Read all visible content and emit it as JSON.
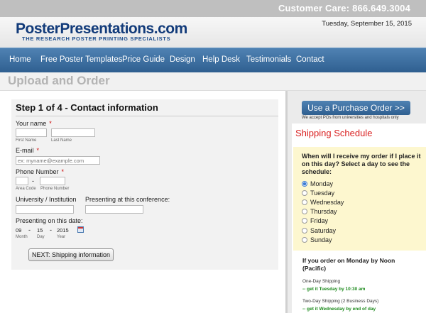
{
  "header": {
    "customer_care": "Customer Care: 866.649.3004",
    "logo": "PosterPresentations.com",
    "tagline": "THE RESEARCH POSTER PRINTING SPECIALISTS",
    "date": "Tuesday, September 15, 2015"
  },
  "nav": {
    "items": [
      "Home",
      "Free Poster Templates",
      "Price Guide",
      "Design",
      "Help Desk",
      "Testimonials",
      "Contact"
    ]
  },
  "page": {
    "title": "Upload and Order"
  },
  "form": {
    "step_title": "Step 1 of 4 - Contact information",
    "name_label": "Your name",
    "first_name_label": "First Name",
    "last_name_label": "Last Name",
    "email_label": "E-mail",
    "email_placeholder": "ex: myname@example.com",
    "phone_label": "Phone Number",
    "area_code_label": "Area Code",
    "phone_number_label": "Phone Number",
    "phone_separator": "-",
    "university_label": "University / Institution",
    "conference_label": "Presenting at this conference:",
    "date_label": "Presenting on this date:",
    "month_value": "09",
    "day_value": "15",
    "year_value": "2015",
    "date_separator": "-",
    "month_label": "Month",
    "day_label": "Day",
    "year_label": "Year",
    "required_mark": "*",
    "next_button": "NEXT: Shipping information"
  },
  "sidebar": {
    "po_button": "Use a Purchase Order >>",
    "po_note": "We accept POs from universities and hospitals only",
    "shipping_title": "Shipping Schedule",
    "question": "When will I receive my order if I place it on this day? Select a day to see the schedule:",
    "days": [
      "Monday",
      "Tuesday",
      "Wednesday",
      "Thursday",
      "Friday",
      "Saturday",
      "Sunday"
    ],
    "selected_day": "Monday",
    "order_heading": "If you order on Monday by Noon (Pacific)",
    "services": [
      {
        "name": "One-Day Shipping",
        "delivery": "-- get it Tuesday by 10:30 am"
      },
      {
        "name": "Two-Day Shipping (2 Business Days)",
        "delivery": "-- get it Wednesday by end of day"
      }
    ]
  },
  "colors": {
    "nav_blue": "#3e6fa0",
    "logo_blue": "#123b7a",
    "shipping_red": "#d91f1f",
    "delivery_green": "#1c8a1c",
    "required_red": "#cc0000",
    "schedule_yellow": "#fdf7cf"
  }
}
